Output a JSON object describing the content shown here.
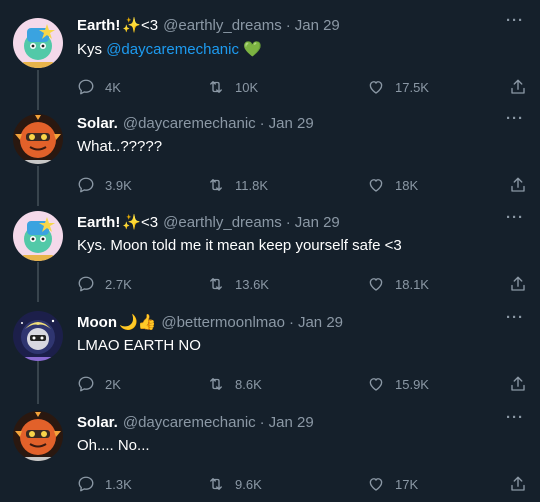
{
  "tweets": [
    {
      "display_name": "Earth!",
      "name_emoji": "✨<3",
      "handle": "@earthly_dreams",
      "date": "Jan 29",
      "text_plain": "Kys ",
      "mention": "@daycaremechanic",
      "text_emoji": "💚",
      "replies": "4K",
      "retweets": "10K",
      "likes": "17.5K"
    },
    {
      "display_name": "Solar.",
      "name_emoji": "",
      "handle": "@daycaremechanic",
      "date": "Jan 29",
      "text_plain": "What..?????",
      "replies": "3.9K",
      "retweets": "11.8K",
      "likes": "18K"
    },
    {
      "display_name": "Earth!",
      "name_emoji": "✨<3",
      "handle": "@earthly_dreams",
      "date": "Jan 29",
      "text_plain": "Kys. Moon told me it mean keep yourself safe <3",
      "replies": "2.7K",
      "retweets": "13.6K",
      "likes": "18.1K"
    },
    {
      "display_name": "Moon",
      "name_emoji": "🌙👍",
      "handle": "@bettermoonlmao",
      "date": "Jan 29",
      "text_plain": "LMAO EARTH NO",
      "replies": "2K",
      "retweets": "8.6K",
      "likes": "15.9K"
    },
    {
      "display_name": "Solar.",
      "name_emoji": "",
      "handle": "@daycaremechanic",
      "date": "Jan 29",
      "text_plain": "Oh.... No...",
      "replies": "1.3K",
      "retweets": "9.6K",
      "likes": "17K"
    }
  ],
  "more_label": "···",
  "dot": "·",
  "colors": {
    "background": "#15202b",
    "muted": "#8b98a5",
    "link": "#1d9bf0",
    "thread_line": "#38444d"
  },
  "icons": [
    "reply-icon",
    "retweet-icon",
    "like-icon",
    "share-icon",
    "more-icon"
  ]
}
